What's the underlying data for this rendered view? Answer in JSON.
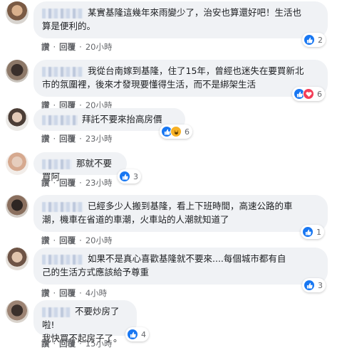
{
  "comments": [
    {
      "text": "某實基隆這幾年來雨變少了，治安也算還好吧！生活也\n算是便利的。",
      "reaction_count": "2",
      "reaction_icons": [
        "like-icon"
      ],
      "like_label": "讚",
      "reply_label": "回覆",
      "time": "20小時"
    },
    {
      "text": "我從台南嫁到基隆，住了15年，曾經也迷失在要買新北\n市的氛圍裡，後來才發現要懂得生活，而不是綁架生活",
      "reaction_count": "6",
      "reaction_icons": [
        "like-icon",
        "love-icon"
      ],
      "like_label": "讚",
      "reply_label": "回覆",
      "time": "20小時"
    },
    {
      "text": "拜託不要來抬高房價",
      "reaction_count": "6",
      "reaction_icons": [
        "like-icon",
        "haha-icon"
      ],
      "like_label": "讚",
      "reply_label": "回覆",
      "time": "23小時"
    },
    {
      "text": "那就不要買阿",
      "reaction_count": "3",
      "reaction_icons": [
        "like-icon"
      ],
      "like_label": "讚",
      "reply_label": "回覆",
      "time": "23小時"
    },
    {
      "text": "已經多少人搬到基隆，看上下班時間，高速公路的車\n潮，機車在省道的車潮，火車站的人潮就知道了",
      "reaction_count": "1",
      "reaction_icons": [
        "like-icon"
      ],
      "like_label": "讚",
      "reply_label": "回覆",
      "time": "20小時"
    },
    {
      "text": "如果不是真心喜歡基隆就不要來....每個城市都有自\n己的生活方式應該給予尊重",
      "reaction_count": "3",
      "reaction_icons": [
        "like-icon"
      ],
      "like_label": "讚",
      "reply_label": "回覆",
      "time": "4小時"
    },
    {
      "text": "不要炒房了啦!\n我快買不起房子了。",
      "reaction_count": "4",
      "reaction_icons": [
        "like-icon"
      ],
      "like_label": "讚",
      "reply_label": "回覆",
      "time": "15小時"
    }
  ],
  "colors": {
    "bubble": "#f0f2f5",
    "meta": "#65676b",
    "like": "#1877f2",
    "love": "#f33e58",
    "haha": "#f7b125"
  }
}
